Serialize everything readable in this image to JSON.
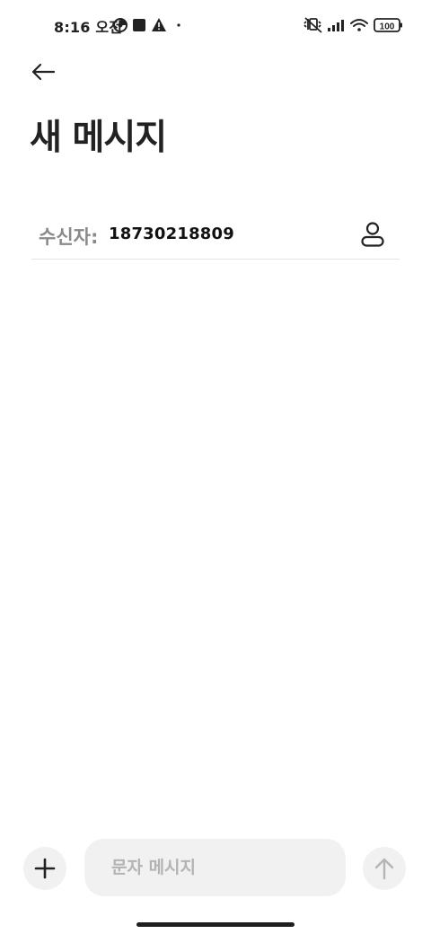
{
  "status_bar": {
    "time": "8:16 오전",
    "battery": "100",
    "icons_left": [
      "data-saver-icon",
      "stop-square-icon",
      "warning-icon",
      "dot-icon"
    ],
    "icons_right": [
      "mute-vibrate-icon",
      "signal-icon",
      "wifi-icon",
      "battery-icon"
    ]
  },
  "header": {
    "back_icon": "arrow-left-icon",
    "title": "새 메시지"
  },
  "recipient": {
    "label": "수신자:",
    "value": "18730218809",
    "contact_icon": "person-icon"
  },
  "composer": {
    "attach_icon": "plus-icon",
    "placeholder": "문자 메시지",
    "value": "",
    "send_icon": "arrow-up-icon"
  },
  "colors": {
    "text": "#222222",
    "muted": "#8a8a8a",
    "placeholder": "#b3b3b3",
    "button_bg": "#f1f1f1",
    "divider": "#e3e3e3"
  }
}
